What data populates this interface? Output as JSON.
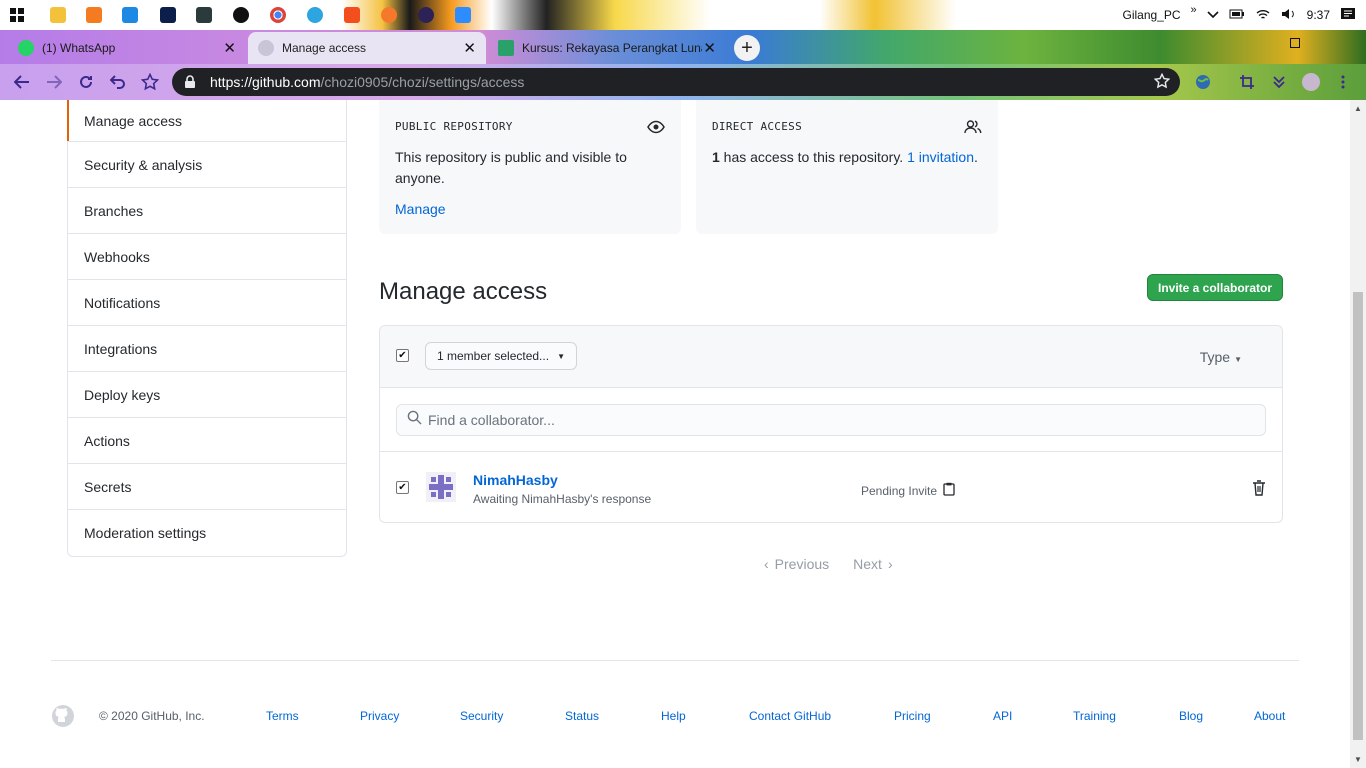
{
  "taskbar": {
    "user": "Gilang_PC",
    "clock": "9:37",
    "chevron": "»"
  },
  "tabs": [
    {
      "label": "(1) WhatsApp",
      "icon": "whatsapp-icon"
    },
    {
      "label": "Manage access",
      "icon": "github-icon"
    },
    {
      "label": "Kursus: Rekayasa Perangkat Luna",
      "icon": "course-icon"
    }
  ],
  "toolbar": {
    "url_host": "https://github.com",
    "url_path": "/chozi0905/chozi/settings/access"
  },
  "sidebar": {
    "items": [
      {
        "label": "Manage access"
      },
      {
        "label": "Security & analysis"
      },
      {
        "label": "Branches"
      },
      {
        "label": "Webhooks"
      },
      {
        "label": "Notifications"
      },
      {
        "label": "Integrations"
      },
      {
        "label": "Deploy keys"
      },
      {
        "label": "Actions"
      },
      {
        "label": "Secrets"
      },
      {
        "label": "Moderation settings"
      }
    ]
  },
  "cards": {
    "public": {
      "title": "PUBLIC REPOSITORY",
      "text": "This repository is public and visible to anyone.",
      "link": "Manage"
    },
    "direct": {
      "title": "DIRECT ACCESS",
      "count": "1",
      "text": " has access to this repository. ",
      "link": "1 invitation",
      "period": "."
    }
  },
  "manage": {
    "title": "Manage access",
    "invite_label": "Invite a collaborator",
    "member_select": "1 member selected...",
    "type_label": "Type",
    "search_placeholder": "Find a collaborator...",
    "collaborator": {
      "name": "NimahHasby",
      "status": "Awaiting NimahHasby's response",
      "pending": "Pending Invite"
    },
    "pager": {
      "previous": "Previous",
      "next": "Next"
    }
  },
  "footer": {
    "copyright": "© 2020 GitHub, Inc.",
    "links": [
      "Terms",
      "Privacy",
      "Security",
      "Status",
      "Help",
      "Contact GitHub",
      "Pricing",
      "API",
      "Training",
      "Blog",
      "About"
    ]
  },
  "colors": {
    "link": "#0366d6",
    "primary_button": "#2ea44f",
    "active_indicator": "#e36209"
  }
}
